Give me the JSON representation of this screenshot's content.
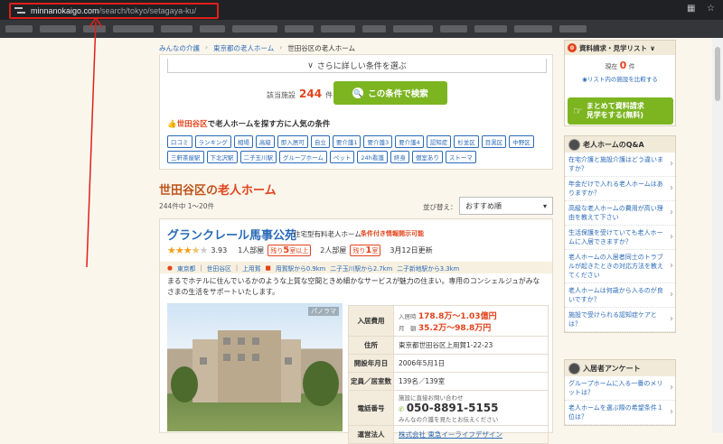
{
  "browser": {
    "url_host": "minnanokaigo.com",
    "url_path": "/search/tokyo/setagaya-ku/"
  },
  "breadcrumb": [
    "みんなの介護",
    "東京都の老人ホーム",
    "世田谷区の老人ホーム"
  ],
  "filter": {
    "more_select": "さらに詳しい条件を選ぶ",
    "count_label": "該当施設",
    "count_value": "244",
    "count_unit": "件",
    "search_button": "この条件で検索",
    "popular_prefix": "世田谷区",
    "popular_suffix": "で老人ホームを探す方に人気の条件",
    "tags": [
      "口コミ",
      "ランキング",
      "相場",
      "高級",
      "即入居可",
      "自立",
      "要介護1",
      "要介護3",
      "要介護4",
      "認知症",
      "杉並区",
      "目黒区",
      "中野区",
      "三軒茶屋駅",
      "下北沢駅",
      "二子玉川駅",
      "グループホーム",
      "ペット",
      "24h看護",
      "終身",
      "個室あり",
      "ストーマ"
    ]
  },
  "results": {
    "title_sub": "世田谷区の",
    "title_main": "老人ホーム",
    "range": "244件中 1〜20件",
    "sort_label": "並び替え：",
    "sort_value": "おすすめ順"
  },
  "facility": {
    "name": "グランクレール馬事公苑",
    "type": "住宅型有料老人ホーム",
    "condition": "条件付き情報開示可能",
    "rating": "3.93",
    "rating_value": 3.93,
    "room1_label": "1人部屋",
    "room1_vac_prefix": "残り",
    "room1_vac_num": "5",
    "room1_vac_suffix": "室以上",
    "room2_label": "2人部屋",
    "room2_vac_prefix": "残り",
    "room2_vac_num": "1",
    "room2_vac_suffix": "室",
    "updated": "3月12日更新",
    "loc_pref": "東京都",
    "loc_ward": "世田谷区",
    "loc_area": "上用賀",
    "station1": "用賀駅から0.9km",
    "station2": "二子玉川駅から2.7km",
    "station3": "二子新地駅から3.3km",
    "description": "まるでホテルに住んでいるかのような上質な空間ときめ細かなサービスが魅力の住まい。専用のコンシェルジュがみなさまの生活をサポートいたします。",
    "panorama": "パノラマ",
    "table": {
      "fee_label": "入居費用",
      "fee_initial_label": "入居時",
      "fee_initial": "178.8万〜1.03億円",
      "fee_monthly_label": "月　額",
      "fee_monthly": "35.2万〜98.8万円",
      "address_label": "住所",
      "address": "東京都世田谷区上用賀1-22-23",
      "open_label": "開設年月日",
      "open": "2006年5月1日",
      "capacity_label": "定員／居室数",
      "capacity": "139名／139室",
      "phone_label": "電話番号",
      "phone_note": "施設に直接お問い合わせ",
      "phone": "050-8891-5155",
      "phone_sub": "みんなの介護を見たとお伝えください",
      "operator_label": "運営法人",
      "operator": "株式会社 東急イーライフデザイン"
    }
  },
  "sidebar": {
    "list_badge": "0",
    "list_title": "資料請求・見学リスト",
    "list_now_label": "現在",
    "list_now_value": "0",
    "list_now_unit": "件",
    "list_compare": "リスト内の施設を比較する",
    "bulk_line1": "まとめて資料請求",
    "bulk_line2": "見学をする(無料)",
    "qa_title": "老人ホームのQ&A",
    "qa_items": [
      "在宅介護と施設介護はどう違いますか？",
      "年金だけで入れる老人ホームはありますか？",
      "高級な老人ホームの費用が高い理由を教えて下さい",
      "生活保護を受けていても老人ホームに入居できますか？",
      "老人ホームの入居者同士のトラブルが起きたときの対応方法を教えてください",
      "老人ホームは何歳から入るのが良いですか？",
      "施設で受けられる認知症ケアとは？"
    ],
    "survey_title": "入居者アンケート",
    "survey_items": [
      "グループホームに入る一番のメリットは？",
      "老人ホームを選ぶ際の希望条件１位は？"
    ]
  }
}
